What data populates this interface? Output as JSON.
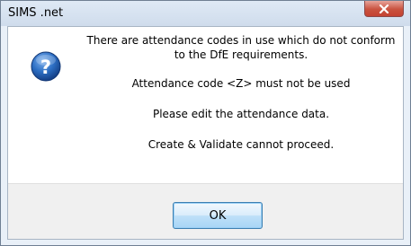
{
  "window": {
    "title": "SIMS .net"
  },
  "dialog": {
    "icon": "question-icon",
    "messages": [
      "There are attendance codes in use which do not conform",
      "to the DfE requirements.",
      "Attendance code <Z> must not be used",
      "Please edit the attendance data.",
      "Create & Validate cannot proceed."
    ],
    "ok_label": "OK"
  },
  "colors": {
    "close_button": "#c9523f",
    "icon_blue": "#1f5fb0",
    "button_border": "#3c7fb1"
  }
}
